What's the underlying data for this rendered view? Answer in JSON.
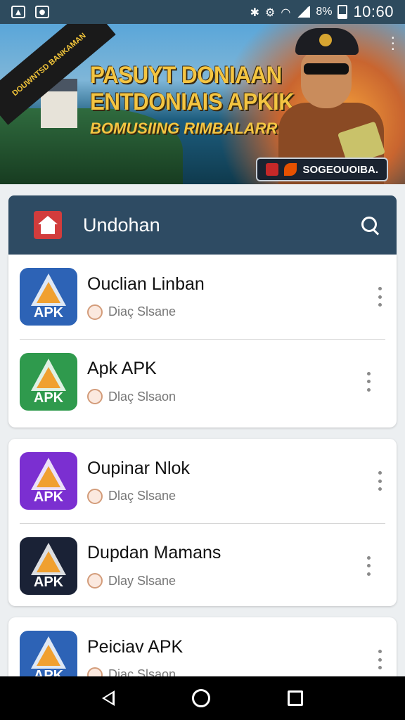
{
  "status_bar": {
    "battery_text": "8%",
    "time": "10:60",
    "icons": [
      "image-icon",
      "notification-icon",
      "bluetooth-icon",
      "settings-icon",
      "wifi-icon",
      "signal-icon",
      "battery-icon"
    ]
  },
  "banner": {
    "ribbon_text": "DOUWNTSD BANKAMAN",
    "line1": "PASUYT DONIAAN",
    "line2": "ENTDONIAIS APKIK",
    "line3": "BOMUSIING RIMBALARRIT!",
    "badge_text": "SOGEOUOIBA."
  },
  "header": {
    "title": "Undohan",
    "accent": "#2e4b63"
  },
  "apps": [
    {
      "title": "Ouclian Linban",
      "subtitle": "Diaç Slsane",
      "icon_label": "APK",
      "icon_color": "#2d63b6"
    },
    {
      "title": "Apk APK",
      "subtitle": "Dlaç Slsaon",
      "icon_label": "APK",
      "icon_color": "#2f9a4d"
    },
    {
      "title": "Oupinar Nlok",
      "subtitle": "Dlaç Slsane",
      "icon_label": "APK",
      "icon_color": "#7b2fd1"
    },
    {
      "title": "Dupdan Mamans",
      "subtitle": "Dlay Slsane",
      "icon_label": "APK",
      "icon_color": "#1a2236"
    },
    {
      "title": "Peiciav APK",
      "subtitle": "Diaç Slsaon",
      "icon_label": "APK",
      "icon_color": "#2d63b6"
    }
  ],
  "nav": {
    "icons": [
      "back-icon",
      "home-icon",
      "recents-icon"
    ]
  }
}
